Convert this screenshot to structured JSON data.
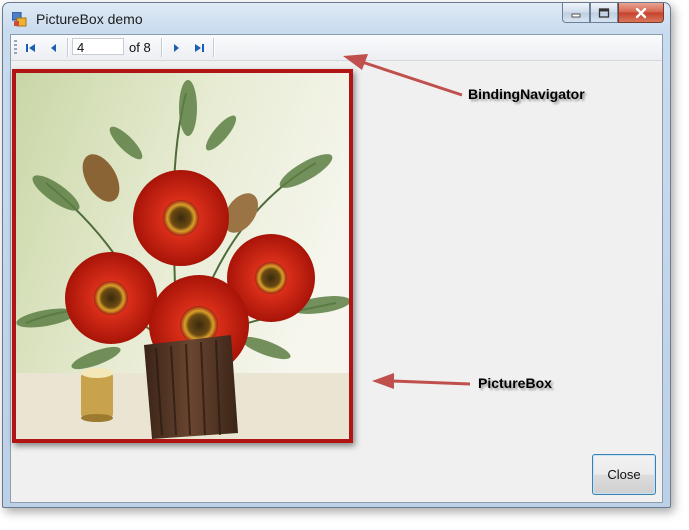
{
  "window": {
    "title": "PictureBox demo",
    "app_icon": "forms-app-icon",
    "caption_buttons": [
      "minimize-icon",
      "maximize-icon",
      "close-icon"
    ]
  },
  "navigator": {
    "buttons": [
      "move-first-icon",
      "move-previous-icon",
      "move-next-icon",
      "move-last-icon"
    ],
    "position_value": "4",
    "count_label": "of 8"
  },
  "picture": {
    "description_icon": "flower-arrangement-image"
  },
  "close_button": {
    "label": "Close"
  },
  "annotations": {
    "navigator_label": "BindingNavigator",
    "picturebox_label": "PictureBox",
    "arrow_color": "#c0504d"
  }
}
